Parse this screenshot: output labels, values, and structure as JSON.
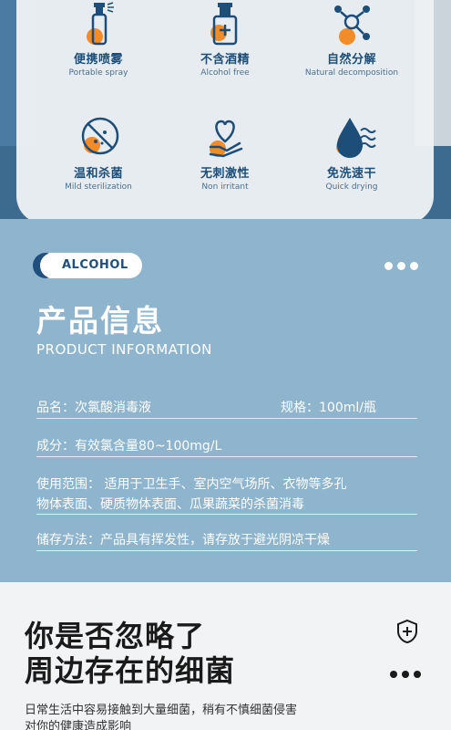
{
  "features": [
    {
      "icon": "spray-bottle-icon",
      "name": "便携喷雾",
      "sub": "Portable spray"
    },
    {
      "icon": "alcohol-bottle-icon",
      "name": "不含酒精",
      "sub": "Alcohol free"
    },
    {
      "icon": "molecule-icon",
      "name": "自然分解",
      "sub": "Natural decomposition"
    },
    {
      "icon": "no-bacteria-icon",
      "name": "温和杀菌",
      "sub": "Mild sterilization"
    },
    {
      "icon": "heart-hand-icon",
      "name": "无刺激性",
      "sub": "Non irritant"
    },
    {
      "icon": "water-drop-icon",
      "name": "免洗速干",
      "sub": "Quick drying"
    }
  ],
  "info": {
    "tag": "ALCOHOL",
    "title": "产品信息",
    "subtitle": "PRODUCT INFORMATION",
    "name_label": "品名：次氯酸消毒液",
    "spec_label": "规格：100ml/瓶",
    "ingredient": "成分：有效氯含量80~100mg/L",
    "usage_line1": "使用范围： 适用于卫生手、室内空气场所、衣物等多孔",
    "usage_line2": "物体表面、硬质物体表面、瓜果蔬菜的杀菌消毒",
    "storage": "储存方法：产品具有挥发性，请存放于避光阴凉干燥"
  },
  "bottom": {
    "title_line1": "你是否忽略了",
    "title_line2": "周边存在的细菌",
    "text_line1": "日常生活中容易接触到大量细菌，稍有不慎细菌侵害",
    "text_line2": "对你的健康造成影响"
  },
  "colors": {
    "accent_orange": "#f28c28",
    "navy": "#1d4e7a",
    "info_bg": "#8eb5cd"
  }
}
